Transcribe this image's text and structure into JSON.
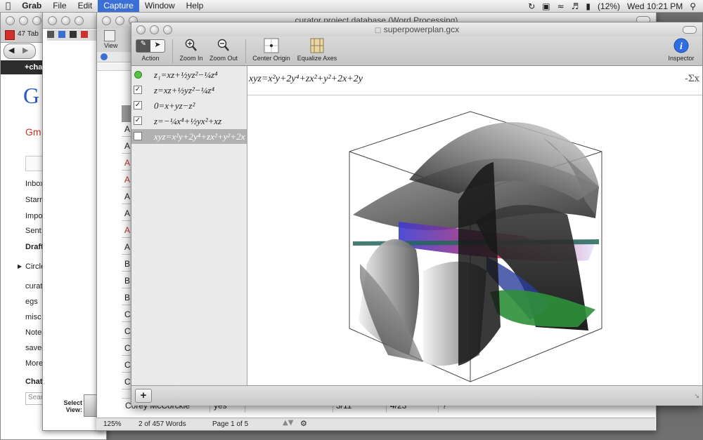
{
  "menubar": {
    "apple": "",
    "app_name": "Grab",
    "items": [
      "File",
      "Edit",
      "Capture",
      "Window",
      "Help"
    ],
    "active": "Capture",
    "battery": "(12%)",
    "clock": "Wed 10:21 PM"
  },
  "browser": {
    "tab_label": "47 Tab",
    "nav_text": "+cha",
    "logo_letter": "G",
    "gmail_label": "Gm",
    "sidebar_items": [
      "Inbox",
      "Starr",
      "Impo",
      "Sent",
      "Draft",
      "Circle",
      "curat",
      "egs",
      "misc",
      "Notes",
      "saved",
      "More",
      "Chat",
      "Sear"
    ]
  },
  "word": {
    "title": "curator project database (Word Processing)",
    "view_label": "View",
    "row_letters": [
      "A",
      "A",
      "A",
      "A",
      "A",
      "A",
      "A",
      "A",
      "B",
      "B",
      "B",
      "C",
      "C",
      "C",
      "C",
      "C"
    ],
    "last_row": [
      "Corey McCorckle",
      "yes",
      "",
      "3/11",
      "4/23",
      "?"
    ],
    "zoom": "125%",
    "word_count": "2 of 457 Words",
    "page": "Page 1 of 5",
    "select_view_label": "Select View:"
  },
  "grapher": {
    "title": "superpowerplan.gcx",
    "tools": [
      {
        "label": "Action",
        "icon": "action-icon"
      },
      {
        "label": "Zoom In",
        "icon": "zoom-in-icon"
      },
      {
        "label": "Zoom Out",
        "icon": "zoom-out-icon"
      },
      {
        "label": "Center Origin",
        "icon": "center-origin-icon"
      },
      {
        "label": "Equalize Axes",
        "icon": "equalize-axes-icon"
      },
      {
        "label": "Inspector",
        "icon": "inspector-icon"
      }
    ],
    "equations": [
      {
        "text": "z₁=xz+½yz²−¼z⁴",
        "checked": false
      },
      {
        "text": "z=xz+½yz²−¼z⁴",
        "checked": true
      },
      {
        "text": "0=x+yz−z²",
        "checked": true
      },
      {
        "text": "z=−¼x⁴+½yx²+xz",
        "checked": true
      },
      {
        "text": "xyz=x²y+2y⁴+zx²+y²+2x",
        "checked": true,
        "selected": true
      }
    ],
    "formula": "xyz=x²y+2y⁴+zx²+y²+2x+2y",
    "sigma_label": "-Σx",
    "add_button": "+"
  }
}
